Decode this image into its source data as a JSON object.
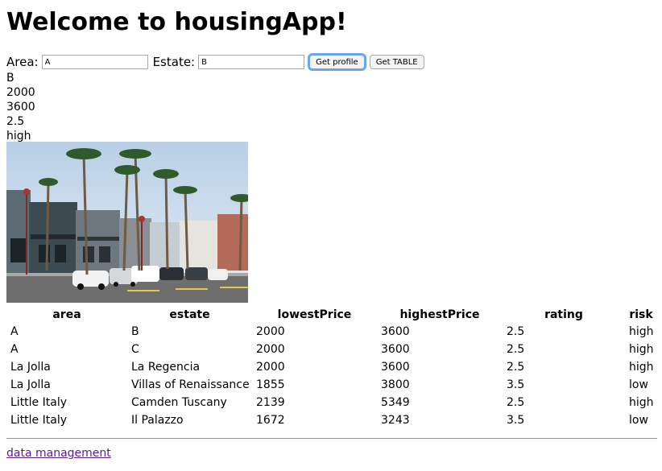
{
  "header": {
    "title": "Welcome to housingApp!"
  },
  "form": {
    "area_label": "Area:",
    "area_value": "A",
    "estate_label": "Estate:",
    "estate_value": "B",
    "get_profile_label": "Get profile",
    "get_table_label": "Get TABLE"
  },
  "profile": {
    "estate": "B",
    "lowestPrice": "2000",
    "highestPrice": "3600",
    "rating": "2.5",
    "risk": "high"
  },
  "table": {
    "headers": [
      "area",
      "estate",
      "lowestPrice",
      "highestPrice",
      "rating",
      "risk"
    ],
    "rows": [
      [
        "A",
        "B",
        "2000",
        "3600",
        "2.5",
        "high"
      ],
      [
        "A",
        "C",
        "2000",
        "3600",
        "2.5",
        "high"
      ],
      [
        "La Jolla",
        "La Regencia",
        "2000",
        "3600",
        "2.5",
        "high"
      ],
      [
        "La Jolla",
        "Villas of Renaissance",
        "1855",
        "3800",
        "3.5",
        "low"
      ],
      [
        "Little Italy",
        "Camden Tuscany",
        "2139",
        "5349",
        "2.5",
        "high"
      ],
      [
        "Little Italy",
        "Il Palazzo",
        "1672",
        "3243",
        "3.5",
        "low"
      ]
    ]
  },
  "footer": {
    "link_label": "data management"
  }
}
